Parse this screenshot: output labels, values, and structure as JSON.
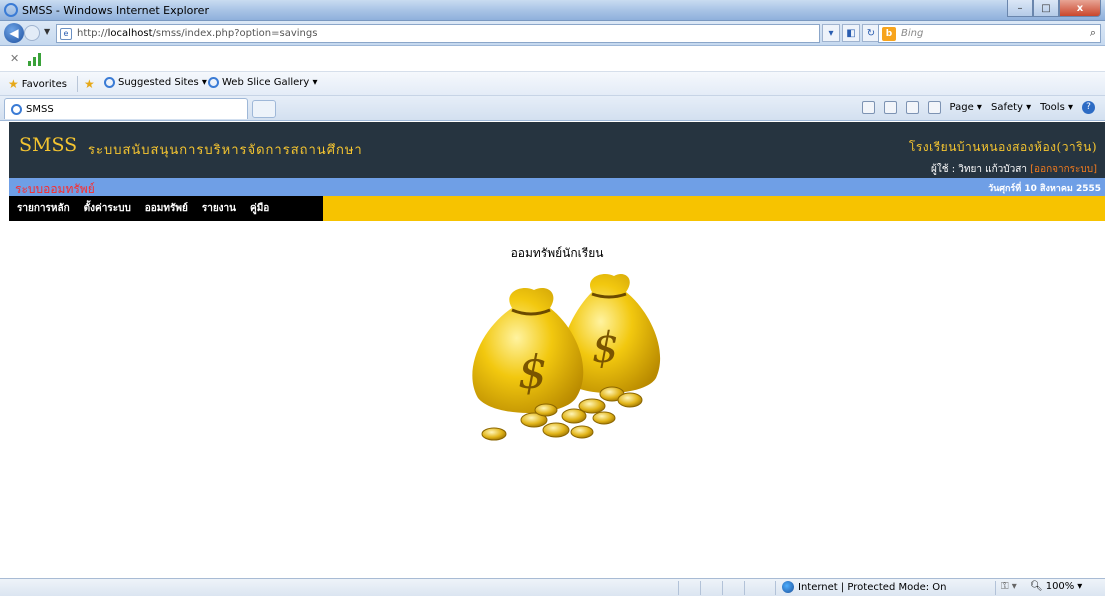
{
  "window": {
    "title": "SMSS - Windows Internet Explorer",
    "controls": [
      "–",
      "□",
      "x"
    ]
  },
  "address": {
    "url_prefix": "http://",
    "url_host": "localhost",
    "url_path": "/smss/index.php?option=savings",
    "search_placeholder": "Bing"
  },
  "favorites": {
    "favorites_label": "Favorites",
    "suggested_label": "Suggested Sites ▾",
    "webslice_label": "Web Slice Gallery ▾"
  },
  "tabs": {
    "active_tab": "SMSS",
    "cmd_page": "Page ▾",
    "cmd_safety": "Safety ▾",
    "cmd_tools": "Tools ▾"
  },
  "site": {
    "brand": "SMSS",
    "brand_subtitle": "ระบบสนับสนุนการบริหารจัดการสถานศึกษา",
    "school": "โรงเรียนบ้านหนองสองห้อง(วาริน)",
    "user_label": "ผู้ใช้ : วิทยา แก้วบัวสา",
    "logout": "[ออกจากระบบ]",
    "system_name": "ระบบออมทรัพย์",
    "date": "วันศุกร์ที่ 10 สิงหาคม 2555",
    "menu": [
      {
        "label": "รายการหลัก"
      },
      {
        "label": "ตั้งค่าระบบ"
      },
      {
        "label": "ออมทรัพย์"
      },
      {
        "label": "รายงาน"
      },
      {
        "label": "คู่มือ"
      }
    ],
    "content_title": "ออมทรัพย์นักเรียน"
  },
  "status": {
    "zone": "Internet | Protected Mode: On",
    "zoom": "100%"
  },
  "colors": {
    "header_bg": "#263440",
    "brand_gold": "#f4c430",
    "subbar_blue": "#6f9fe6",
    "system_red": "#ff2a2a",
    "menu_yellow": "#f7c300",
    "logout_orange": "#f07a1e"
  }
}
